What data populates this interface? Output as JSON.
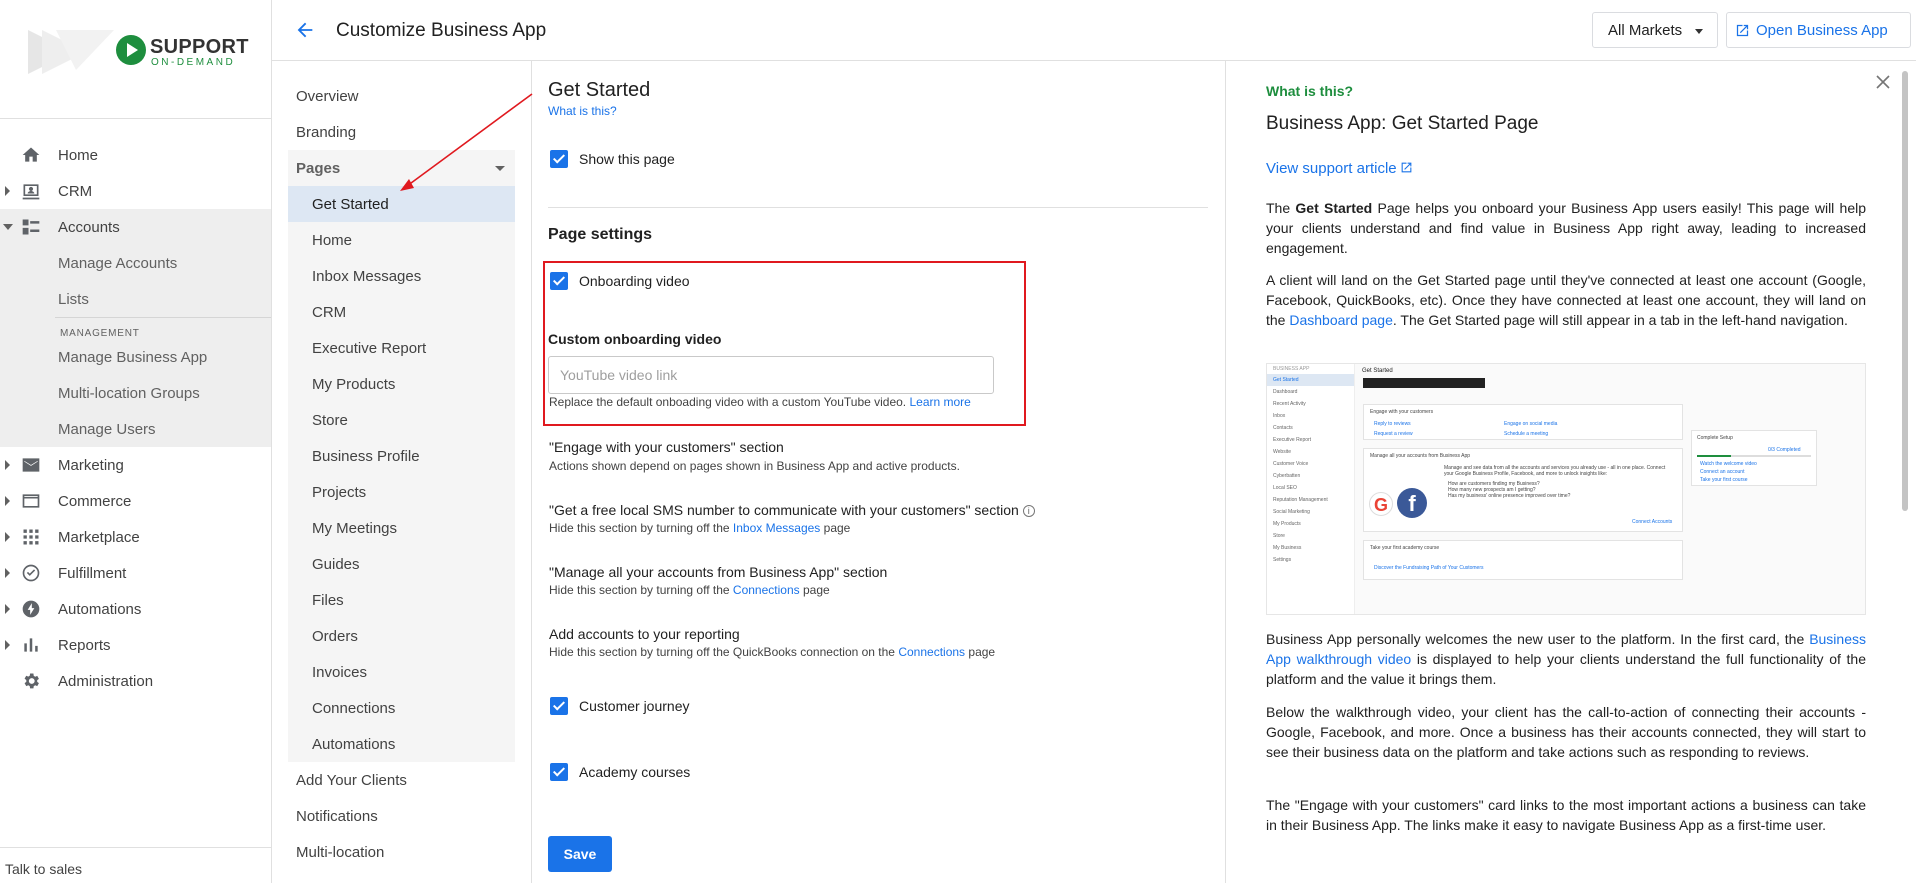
{
  "brand": {
    "name": "SUPPORT",
    "sub": "ON-DEMAND"
  },
  "app_nav": {
    "items": [
      {
        "label": "Home",
        "icon": "home-icon"
      },
      {
        "label": "CRM",
        "icon": "crm-icon"
      },
      {
        "label": "Accounts",
        "icon": "accounts-icon",
        "expanded": true
      },
      {
        "label": "Marketing",
        "icon": "mail-icon"
      },
      {
        "label": "Commerce",
        "icon": "commerce-icon"
      },
      {
        "label": "Marketplace",
        "icon": "grid-icon"
      },
      {
        "label": "Fulfillment",
        "icon": "check-circle-icon"
      },
      {
        "label": "Automations",
        "icon": "bolt-icon"
      },
      {
        "label": "Reports",
        "icon": "bar-chart-icon"
      },
      {
        "label": "Administration",
        "icon": "gear-icon"
      }
    ],
    "accounts_sub": [
      "Manage Accounts",
      "Lists"
    ],
    "management_head": "MANAGEMENT",
    "management_sub": [
      "Manage Business App",
      "Multi-location Groups",
      "Manage Users"
    ],
    "talk_to_sales": "Talk to sales"
  },
  "header": {
    "title": "Customize Business App",
    "market_select": "All Markets",
    "open_app": "Open Business App"
  },
  "sec_nav": {
    "top": [
      "Overview",
      "Branding"
    ],
    "pages_label": "Pages",
    "pages": [
      "Get Started",
      "Home",
      "Inbox Messages",
      "CRM",
      "Executive Report",
      "My Products",
      "Store",
      "Business Profile",
      "Projects",
      "My Meetings",
      "Guides",
      "Files",
      "Orders",
      "Invoices",
      "Connections",
      "Automations"
    ],
    "bottom": [
      "Add Your Clients",
      "Notifications",
      "Multi-location"
    ]
  },
  "main": {
    "title": "Get Started",
    "what_link": "What is this?",
    "show_page": "Show this page",
    "settings_title": "Page settings",
    "onboarding_video": "Onboarding video",
    "custom_video_label": "Custom onboarding video",
    "video_placeholder": "YouTube video link",
    "video_hint": "Replace the default onboading video with a custom YouTube video.",
    "learn_more": "Learn more",
    "engage_head": "\"Engage with your customers\" section",
    "engage_hint": "Actions shown depend on pages shown in Business App and active products.",
    "sms_head": "\"Get a free local SMS number to communicate with your customers\" section",
    "sms_hint_pre": "Hide this section by turning off the",
    "sms_link": "Inbox Messages",
    "sms_hint_post": "page",
    "manage_head": "\"Manage all your accounts from Business App\" section",
    "manage_hint_pre": "Hide this section by turning off the",
    "manage_link": "Connections",
    "manage_hint_post": "page",
    "reporting_head": "Add accounts to your reporting",
    "reporting_hint_pre": "Hide this section by turning off the QuickBooks connection on the",
    "reporting_link": "Connections",
    "reporting_hint_post": "page",
    "customer_journey": "Customer journey",
    "academy_courses": "Academy courses",
    "save": "Save"
  },
  "help": {
    "what": "What is this?",
    "title": "Business App: Get Started Page",
    "support_link": "View support article",
    "p1_pre": "The",
    "p1_bold": "Get Started",
    "p1_post": "Page helps you onboard your Business App users easily! This page will help your clients understand and find value in Business App right away, leading to increased engagement.",
    "p2_pre": "A client will land on the Get Started page until they've connected at least one account (Google, Facebook, QuickBooks, etc). Once they have connected at least one account, they will land on the",
    "p2_link": "Dashboard page",
    "p2_post": ". The Get Started page will still appear in a tab in the left-hand navigation.",
    "p3_pre": "Business App personally welcomes the new user to the platform. In the first card, the",
    "p3_link": "Business App walkthrough video",
    "p3_post": "is displayed to help your clients understand the full functionality of the platform and the value it brings them.",
    "p4": "Below the walkthrough video, your client has the call-to-action of connecting their accounts - Google, Facebook, and more. Once a business has their accounts connected, they will start to see their business data on the platform and take actions such as responding to reviews.",
    "p5": "The \"Engage with your customers\" card links to the most important actions a business can take in their Business App. The links make it easy to navigate Business App as a first-time user.",
    "shot": {
      "brand": "BUSINESS APP",
      "heading": "Get Started",
      "side": [
        "Get Started",
        "Dashboard",
        "Recent Activity",
        "Inbox",
        "Contacts",
        "Executive Report",
        "Website",
        "Customer Voice",
        "Cyberbatten",
        "Local SEO",
        "Reputation Management",
        "Social Marketing",
        "My Products",
        "Store",
        "My Business",
        "Settings"
      ],
      "engage": "Engage with your customers",
      "engage_links": [
        "Reply to reviews",
        "Engage on social media",
        "Request a review",
        "Schedule a meeting"
      ],
      "manage": "Manage all your accounts from Business App",
      "manage_text": [
        "Manage and see data from all the accounts and services you already use - all in one place. Connect your Google Business Profile, Facebook, and more to unlock insights like:",
        "How are customers finding my Business?",
        "How many new prospects am I getting?",
        "Has my business' online presence improved over time?"
      ],
      "connect": "Connect Accounts",
      "academy": "Take your first academy course",
      "academy_link": "Discover the Fundraising Path of Your Customers",
      "setup": "Complete Setup",
      "setup_progress": "0/3 Completed",
      "setup_items": [
        "Watch the welcome video",
        "Connect an account",
        "Take your first course"
      ]
    }
  }
}
